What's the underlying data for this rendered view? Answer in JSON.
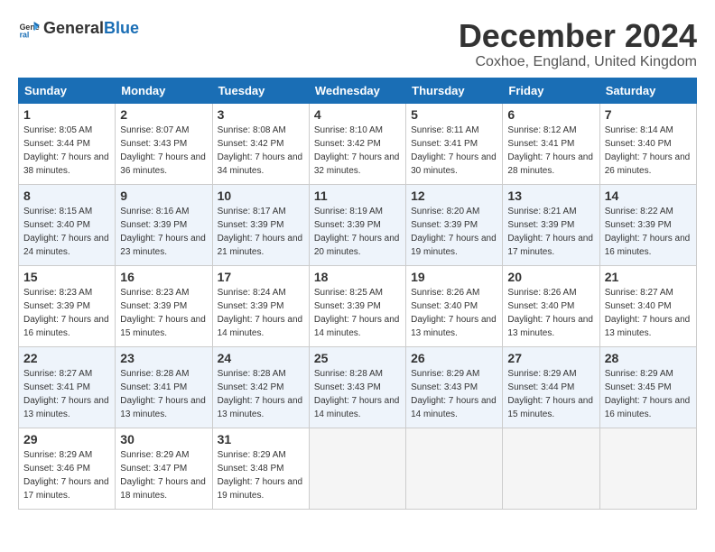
{
  "header": {
    "logo_general": "General",
    "logo_blue": "Blue",
    "title": "December 2024",
    "subtitle": "Coxhoe, England, United Kingdom"
  },
  "weekdays": [
    "Sunday",
    "Monday",
    "Tuesday",
    "Wednesday",
    "Thursday",
    "Friday",
    "Saturday"
  ],
  "weeks": [
    [
      {
        "day": "1",
        "sunrise": "8:05 AM",
        "sunset": "3:44 PM",
        "daylight": "7 hours and 38 minutes."
      },
      {
        "day": "2",
        "sunrise": "8:07 AM",
        "sunset": "3:43 PM",
        "daylight": "7 hours and 36 minutes."
      },
      {
        "day": "3",
        "sunrise": "8:08 AM",
        "sunset": "3:42 PM",
        "daylight": "7 hours and 34 minutes."
      },
      {
        "day": "4",
        "sunrise": "8:10 AM",
        "sunset": "3:42 PM",
        "daylight": "7 hours and 32 minutes."
      },
      {
        "day": "5",
        "sunrise": "8:11 AM",
        "sunset": "3:41 PM",
        "daylight": "7 hours and 30 minutes."
      },
      {
        "day": "6",
        "sunrise": "8:12 AM",
        "sunset": "3:41 PM",
        "daylight": "7 hours and 28 minutes."
      },
      {
        "day": "7",
        "sunrise": "8:14 AM",
        "sunset": "3:40 PM",
        "daylight": "7 hours and 26 minutes."
      }
    ],
    [
      {
        "day": "8",
        "sunrise": "8:15 AM",
        "sunset": "3:40 PM",
        "daylight": "7 hours and 24 minutes."
      },
      {
        "day": "9",
        "sunrise": "8:16 AM",
        "sunset": "3:39 PM",
        "daylight": "7 hours and 23 minutes."
      },
      {
        "day": "10",
        "sunrise": "8:17 AM",
        "sunset": "3:39 PM",
        "daylight": "7 hours and 21 minutes."
      },
      {
        "day": "11",
        "sunrise": "8:19 AM",
        "sunset": "3:39 PM",
        "daylight": "7 hours and 20 minutes."
      },
      {
        "day": "12",
        "sunrise": "8:20 AM",
        "sunset": "3:39 PM",
        "daylight": "7 hours and 19 minutes."
      },
      {
        "day": "13",
        "sunrise": "8:21 AM",
        "sunset": "3:39 PM",
        "daylight": "7 hours and 17 minutes."
      },
      {
        "day": "14",
        "sunrise": "8:22 AM",
        "sunset": "3:39 PM",
        "daylight": "7 hours and 16 minutes."
      }
    ],
    [
      {
        "day": "15",
        "sunrise": "8:23 AM",
        "sunset": "3:39 PM",
        "daylight": "7 hours and 16 minutes."
      },
      {
        "day": "16",
        "sunrise": "8:23 AM",
        "sunset": "3:39 PM",
        "daylight": "7 hours and 15 minutes."
      },
      {
        "day": "17",
        "sunrise": "8:24 AM",
        "sunset": "3:39 PM",
        "daylight": "7 hours and 14 minutes."
      },
      {
        "day": "18",
        "sunrise": "8:25 AM",
        "sunset": "3:39 PM",
        "daylight": "7 hours and 14 minutes."
      },
      {
        "day": "19",
        "sunrise": "8:26 AM",
        "sunset": "3:40 PM",
        "daylight": "7 hours and 13 minutes."
      },
      {
        "day": "20",
        "sunrise": "8:26 AM",
        "sunset": "3:40 PM",
        "daylight": "7 hours and 13 minutes."
      },
      {
        "day": "21",
        "sunrise": "8:27 AM",
        "sunset": "3:40 PM",
        "daylight": "7 hours and 13 minutes."
      }
    ],
    [
      {
        "day": "22",
        "sunrise": "8:27 AM",
        "sunset": "3:41 PM",
        "daylight": "7 hours and 13 minutes."
      },
      {
        "day": "23",
        "sunrise": "8:28 AM",
        "sunset": "3:41 PM",
        "daylight": "7 hours and 13 minutes."
      },
      {
        "day": "24",
        "sunrise": "8:28 AM",
        "sunset": "3:42 PM",
        "daylight": "7 hours and 13 minutes."
      },
      {
        "day": "25",
        "sunrise": "8:28 AM",
        "sunset": "3:43 PM",
        "daylight": "7 hours and 14 minutes."
      },
      {
        "day": "26",
        "sunrise": "8:29 AM",
        "sunset": "3:43 PM",
        "daylight": "7 hours and 14 minutes."
      },
      {
        "day": "27",
        "sunrise": "8:29 AM",
        "sunset": "3:44 PM",
        "daylight": "7 hours and 15 minutes."
      },
      {
        "day": "28",
        "sunrise": "8:29 AM",
        "sunset": "3:45 PM",
        "daylight": "7 hours and 16 minutes."
      }
    ],
    [
      {
        "day": "29",
        "sunrise": "8:29 AM",
        "sunset": "3:46 PM",
        "daylight": "7 hours and 17 minutes."
      },
      {
        "day": "30",
        "sunrise": "8:29 AM",
        "sunset": "3:47 PM",
        "daylight": "7 hours and 18 minutes."
      },
      {
        "day": "31",
        "sunrise": "8:29 AM",
        "sunset": "3:48 PM",
        "daylight": "7 hours and 19 minutes."
      },
      null,
      null,
      null,
      null
    ]
  ]
}
